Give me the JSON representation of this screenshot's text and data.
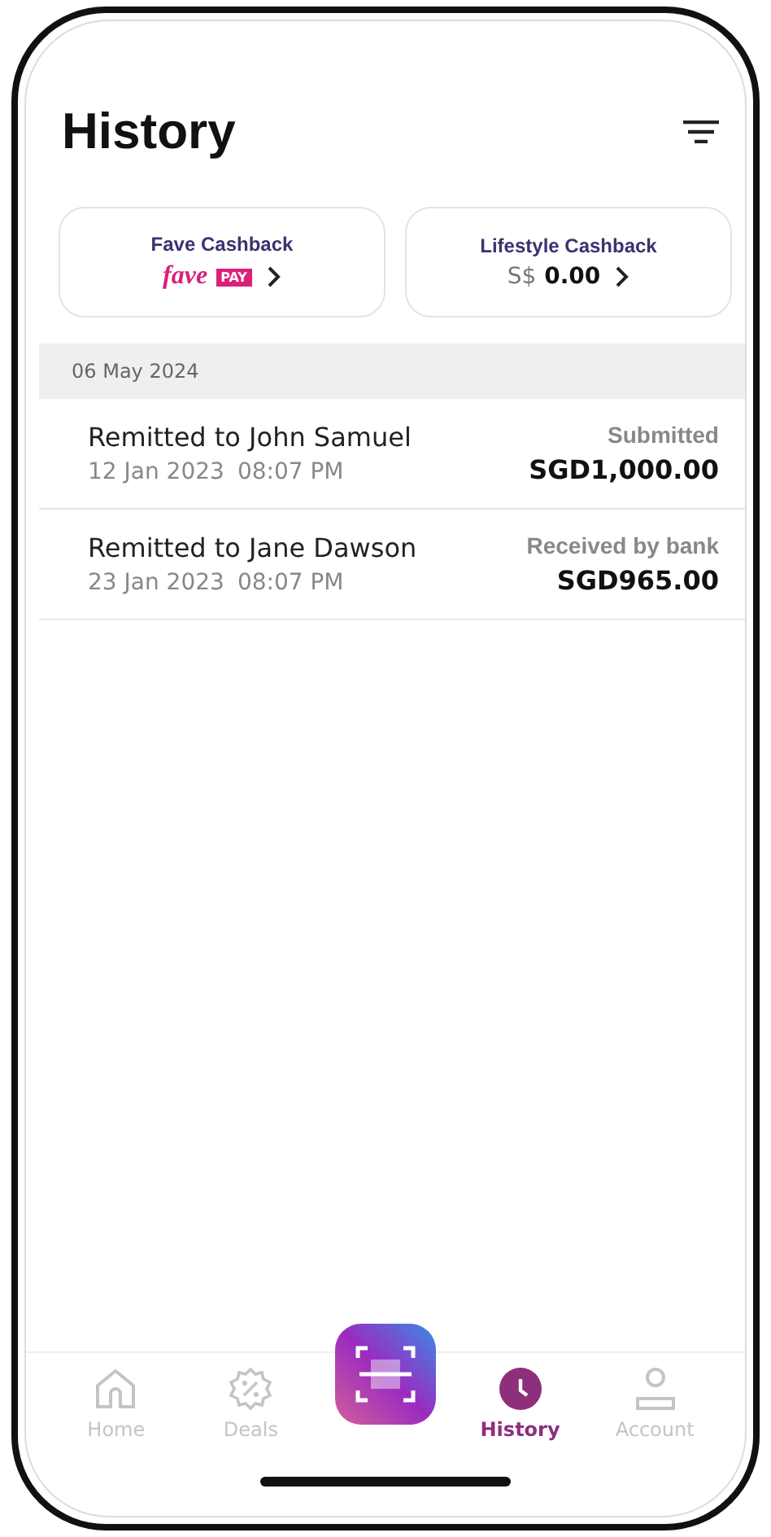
{
  "header": {
    "title": "History"
  },
  "cashback_cards": [
    {
      "kind": "logo",
      "title": "Fave Cashback",
      "logo_word": "fave",
      "logo_badge": "PAY"
    },
    {
      "kind": "amount",
      "title": "Lifestyle Cashback",
      "currency": "S$",
      "amount": "0.00"
    }
  ],
  "date_header": "06 May 2024",
  "transactions": [
    {
      "title": "Remitted to John Samuel",
      "date": "12 Jan 2023",
      "time": "08:07 PM",
      "status": "Submitted",
      "amount": "SGD1,000.00"
    },
    {
      "title": "Remitted to Jane Dawson",
      "date": "23 Jan 2023",
      "time": "08:07 PM",
      "status": "Received by bank",
      "amount": "SGD965.00"
    }
  ],
  "bottom_nav": [
    {
      "kind": "home",
      "label": "Home",
      "selected": false
    },
    {
      "kind": "deals",
      "label": "Deals",
      "selected": false
    },
    {
      "kind": "scan",
      "selected": false
    },
    {
      "kind": "history",
      "label": "History",
      "selected": true
    },
    {
      "kind": "account",
      "label": "Account",
      "selected": false
    }
  ]
}
